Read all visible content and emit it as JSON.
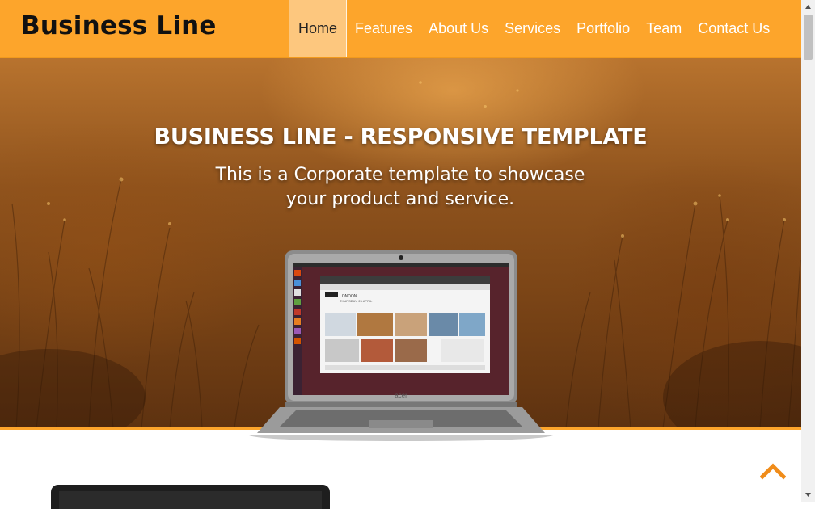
{
  "brand": "Business Line",
  "nav": {
    "items": [
      {
        "label": "Home",
        "active": true
      },
      {
        "label": "Features"
      },
      {
        "label": "About Us"
      },
      {
        "label": "Services"
      },
      {
        "label": "Portfolio"
      },
      {
        "label": "Team"
      },
      {
        "label": "Contact Us"
      }
    ]
  },
  "hero": {
    "title": "BUSINESS LINE - RESPONSIVE TEMPLATE",
    "subtitle_line1": "This is a Corporate template to showcase",
    "subtitle_line2": "your product and service."
  },
  "laptop_screen": {
    "site_label": "BBC",
    "city": "LONDON",
    "date": "THURSDAY, 26 APRIL",
    "brand": "acer"
  },
  "icons": {
    "scroll_top": "chevron-up-icon"
  },
  "colors": {
    "accent": "#fda52b",
    "nav_active_bg": "#fdc77e"
  }
}
